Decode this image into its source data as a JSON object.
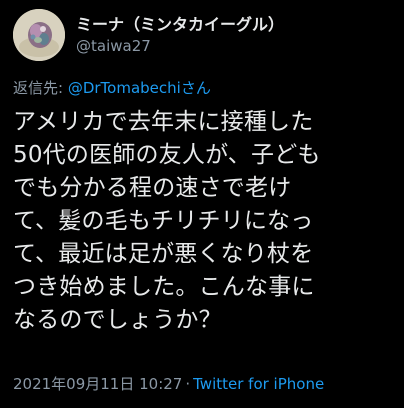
{
  "author": {
    "display_name": "ミーナ（ミンタカイーグル）",
    "handle": "@taiwa27"
  },
  "reply": {
    "prefix": "返信先: ",
    "mention": "@DrTomabechi",
    "suffix": "さん"
  },
  "body": {
    "lines": [
      "アメリカで去年末に接種した",
      "50代の医師の友人が、子ども",
      "でも分かる程の速さで老け",
      "て、髪の毛もチリチリになっ",
      "て、最近は足が悪くなり杖を",
      "つき始めました。こんな事に",
      "なるのでしょうか？"
    ]
  },
  "meta": {
    "timestamp": "2021年09月11日 10:27",
    "separator": "·",
    "client": "Twitter for iPhone"
  },
  "colors": {
    "background": "#000000",
    "text": "#e7e9ea",
    "secondary": "#8b98a5",
    "link": "#1d9bf0"
  }
}
